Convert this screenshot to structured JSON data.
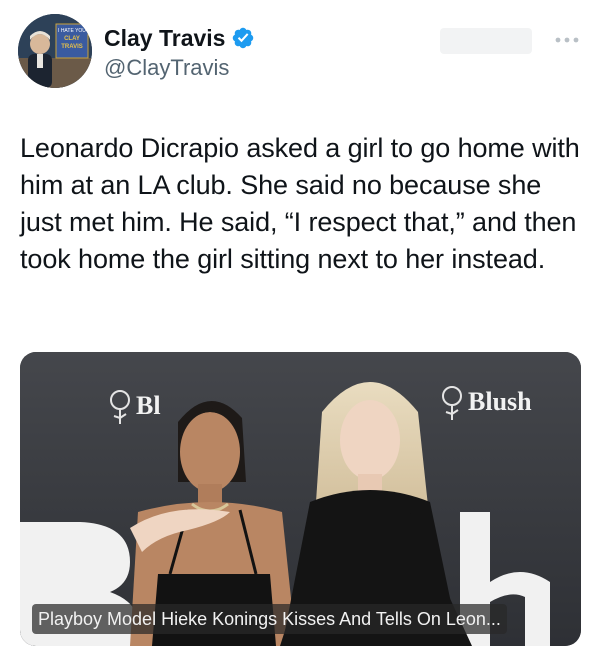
{
  "author": {
    "display_name": "Clay Travis",
    "handle": "@ClayTravis",
    "verified": true,
    "avatar_sign_text": [
      "I HATE YOU",
      "CLAY",
      "TRAVIS"
    ]
  },
  "tweet": {
    "text": "Leonardo Dicrapio asked a girl to go home with him at an LA club. She said no because she just met him. He said, “I respect that,” and then took home the girl sitting next to her instead."
  },
  "media": {
    "headline": "Playboy Model Hieke Konings Kisses And Tells On Leon...",
    "backdrop_logo_left": "Bl",
    "backdrop_logo_right": "Blush"
  },
  "colors": {
    "verified": "#1d9bf0",
    "text": "#0f1419",
    "secondary": "#536471"
  },
  "icons": {
    "more": "more-horizontal-icon",
    "verified": "verified-badge-icon"
  }
}
